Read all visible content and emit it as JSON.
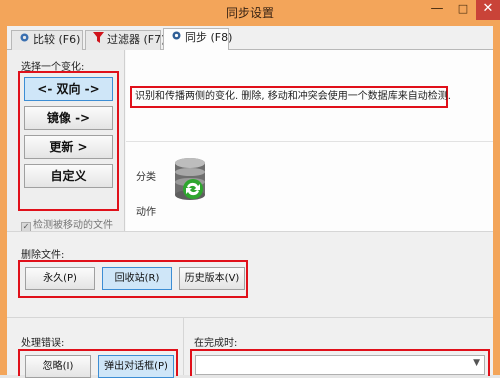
{
  "window": {
    "title": "同步设置",
    "min": "—",
    "max": "□",
    "close": "✕"
  },
  "tabs": [
    {
      "label": "比较 (F6)",
      "icon": "gear-icon"
    },
    {
      "label": "过滤器 (F7)",
      "icon": "filter-icon"
    },
    {
      "label": "同步 (F8)",
      "icon": "gear-icon"
    }
  ],
  "variant": {
    "label": "选择一个变化:",
    "buttons": [
      "<- 双向 ->",
      "镜像 ->",
      "更新 >",
      "自定义"
    ],
    "selected": 0,
    "detect_moved": "检测被移动的文件"
  },
  "description": "识别和传播两侧的变化. 删除, 移动和冲突会使用一个数据库来自动检测.",
  "category_label": "分类",
  "action_label": "动作",
  "deletion": {
    "label": "删除文件:",
    "buttons": [
      "永久(P)",
      "回收站(R)",
      "历史版本(V)"
    ],
    "selected": 1
  },
  "errors": {
    "label": "处理错误:",
    "buttons": [
      "忽略(I)",
      "弹出对话框(P)"
    ],
    "selected": 1
  },
  "on_completion": {
    "label": "在完成时:",
    "value": ""
  },
  "colors": {
    "accent_red": "#e0101a",
    "titlebar": "#f3a55a",
    "selected_button": "#cfe6f8"
  }
}
